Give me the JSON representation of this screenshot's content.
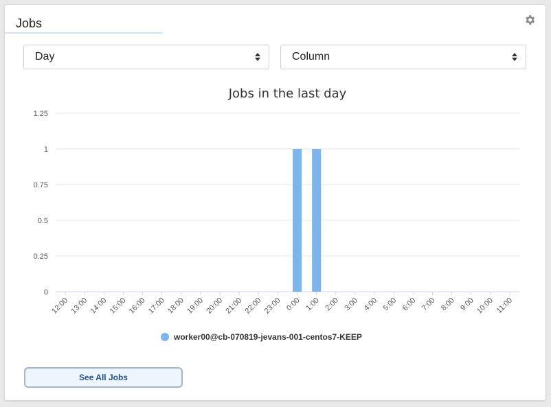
{
  "panel": {
    "title": "Jobs",
    "settings_icon": "gear-icon"
  },
  "filters": {
    "period": "Day",
    "chart_type": "Column"
  },
  "chart_data": {
    "type": "bar",
    "title": "Jobs in the last day",
    "xlabel": "",
    "ylabel": "",
    "ylim": [
      0,
      1.25
    ],
    "yticks": [
      "0",
      "0.25",
      "0.5",
      "0.75",
      "1",
      "1.25"
    ],
    "categories": [
      "12:00",
      "13:00",
      "14:00",
      "15:00",
      "16:00",
      "17:00",
      "18:00",
      "19:00",
      "20:00",
      "21:00",
      "22:00",
      "23:00",
      "0:00",
      "1:00",
      "2:00",
      "3:00",
      "4:00",
      "5:00",
      "6:00",
      "7:00",
      "8:00",
      "9:00",
      "10:00",
      "11:00"
    ],
    "series": [
      {
        "name": "worker00@cb-070819-jevans-001-centos7-KEEP",
        "color": "#7cb5ec",
        "values": [
          0,
          0,
          0,
          0,
          0,
          0,
          0,
          0,
          0,
          0,
          0,
          0,
          1,
          1,
          0,
          0,
          0,
          0,
          0,
          0,
          0,
          0,
          0,
          0
        ]
      }
    ],
    "legend_position": "bottom",
    "grid": true
  },
  "actions": {
    "see_all_label": "See All Jobs"
  }
}
